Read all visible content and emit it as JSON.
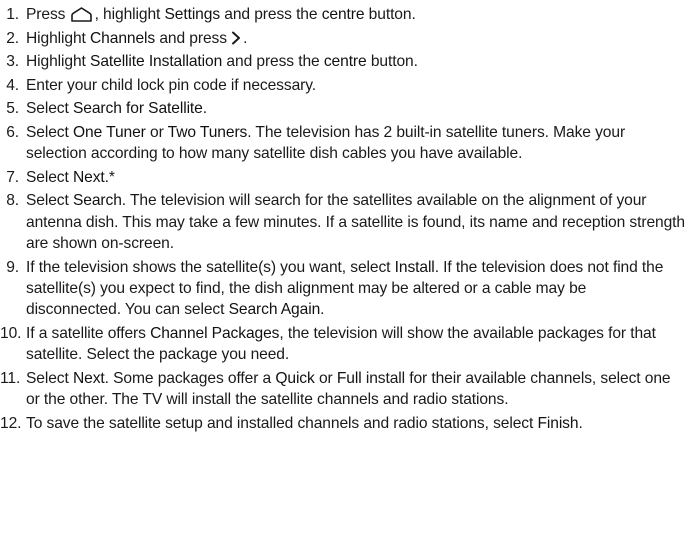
{
  "steps": [
    {
      "n": "1.",
      "parts": [
        "Press ",
        "",
        ", highlight ",
        "Settings",
        " and press the ",
        "centre",
        " button."
      ]
    },
    {
      "n": "2.",
      "parts": [
        "Highlight ",
        "Channels",
        " and press ",
        "",
        "."
      ]
    },
    {
      "n": "3.",
      "parts": [
        "Highlight ",
        "Satellite Installation",
        " and press the ",
        "centre",
        " button."
      ]
    },
    {
      "n": "4.",
      "parts": [
        "Enter your child lock pin code if necessary."
      ]
    },
    {
      "n": "5.",
      "parts": [
        "Select ",
        "Search for Satellite",
        "."
      ]
    },
    {
      "n": "6.",
      "parts": [
        "Select ",
        "One Tuner",
        " or ",
        "Two Tuners",
        ". The television has 2 built-in satellite tuners. Make your selection according to how many satellite dish cables you have available."
      ]
    },
    {
      "n": "7.",
      "parts": [
        "Select ",
        "Next",
        ".*"
      ]
    },
    {
      "n": "8.",
      "parts": [
        "Select ",
        "Search",
        ". The television will search for the satellites available on the alignment of your antenna dish. This may take a few minutes. If a satellite is found, its name and reception strength are shown on-screen."
      ]
    },
    {
      "n": "9.",
      "parts": [
        "If the television shows the satellite(s) you want, select ",
        "Install",
        ". If the television does not find the satellite(s) you expect to find, the dish alignment may be altered or a cable may be disconnected. You can select ",
        "Search Again",
        "."
      ]
    },
    {
      "n": "10.",
      "parts": [
        "If a satellite offers ",
        "Channel Packages",
        ", the television will show the available packages for that satellite. Select the package you need."
      ]
    },
    {
      "n": "11.",
      "parts": [
        "Select ",
        "Next",
        ". Some packages offer a ",
        "Quick",
        " or ",
        "Full",
        " install for their available channels, select one or the other. The TV will install the satellite channels and radio stations."
      ]
    },
    {
      "n": "12.",
      "parts": [
        "To save the satellite setup and installed channels and radio stations, select ",
        "Finish",
        "."
      ]
    }
  ],
  "icons": {
    "home": "home-icon",
    "right": "chevron-right-icon"
  }
}
